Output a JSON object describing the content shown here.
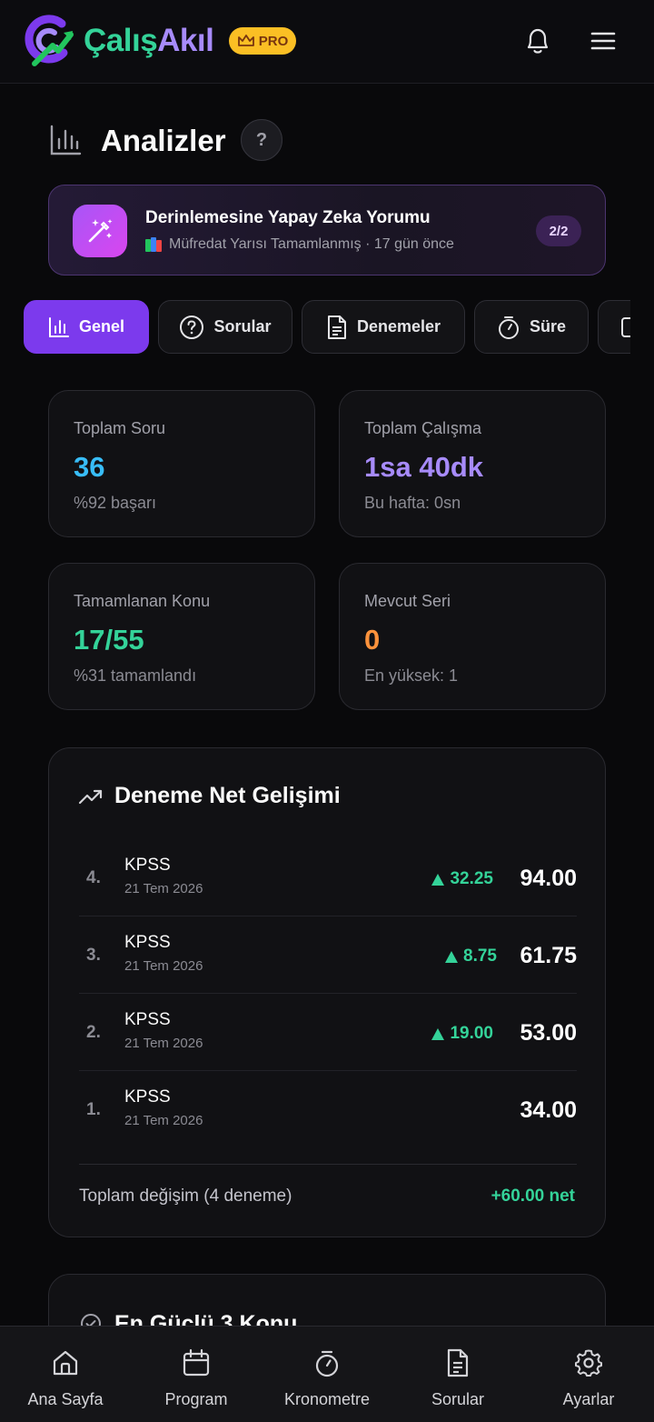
{
  "header": {
    "logo_part1": "Çalış",
    "logo_part2": "Akıl",
    "pro_label": "PRO",
    "bell_icon": "bell-icon",
    "menu_icon": "hamburger-menu-icon"
  },
  "page": {
    "title": "Analizler",
    "help_label": "?"
  },
  "ai_banner": {
    "title": "Derinlemesine Yapay Zeka Yorumu",
    "subtitle": "Müfredat Yarısı Tamamlanmış · 17 gün önce",
    "count": "2/2",
    "icon": "magic-wand-icon"
  },
  "tabs": [
    {
      "label": "Genel",
      "icon": "bar-chart-icon",
      "active": true
    },
    {
      "label": "Sorular",
      "icon": "question-circle-icon",
      "active": false
    },
    {
      "label": "Denemeler",
      "icon": "document-icon",
      "active": false
    },
    {
      "label": "Süre",
      "icon": "stopwatch-icon",
      "active": false
    }
  ],
  "stats": [
    {
      "label": "Toplam Soru",
      "value": "36",
      "sub": "%92 başarı",
      "color": "#38bdf8"
    },
    {
      "label": "Toplam Çalışma",
      "value": "1sa 40dk",
      "sub": "Bu hafta: 0sn",
      "color": "#a78bfa"
    },
    {
      "label": "Tamamlanan Konu",
      "value": "17/55",
      "sub": "%31 tamamlandı",
      "color": "#34d399"
    },
    {
      "label": "Mevcut Seri",
      "value": "0",
      "sub": "En yüksek: 1",
      "color": "#fb923c"
    }
  ],
  "progress": {
    "title": "Deneme Net Gelişimi",
    "rows": [
      {
        "num": "4.",
        "exam": "KPSS",
        "date": "21 Tem 2026",
        "delta": "32.25",
        "net": "94.00"
      },
      {
        "num": "3.",
        "exam": "KPSS",
        "date": "21 Tem 2026",
        "delta": "8.75",
        "net": "61.75"
      },
      {
        "num": "2.",
        "exam": "KPSS",
        "date": "21 Tem 2026",
        "delta": "19.00",
        "net": "53.00"
      },
      {
        "num": "1.",
        "exam": "KPSS",
        "date": "21 Tem 2026",
        "delta": "",
        "net": "34.00"
      }
    ],
    "total_label": "Toplam değişim (4 deneme)",
    "total_value": "+60.00 net"
  },
  "next_card": {
    "title": "En Güçlü 3 Konu"
  },
  "bottom_nav": [
    {
      "label": "Ana Sayfa",
      "icon": "home-icon"
    },
    {
      "label": "Program",
      "icon": "calendar-icon"
    },
    {
      "label": "Kronometre",
      "icon": "stopwatch-icon"
    },
    {
      "label": "Sorular",
      "icon": "document-icon"
    },
    {
      "label": "Ayarlar",
      "icon": "gear-icon"
    }
  ]
}
